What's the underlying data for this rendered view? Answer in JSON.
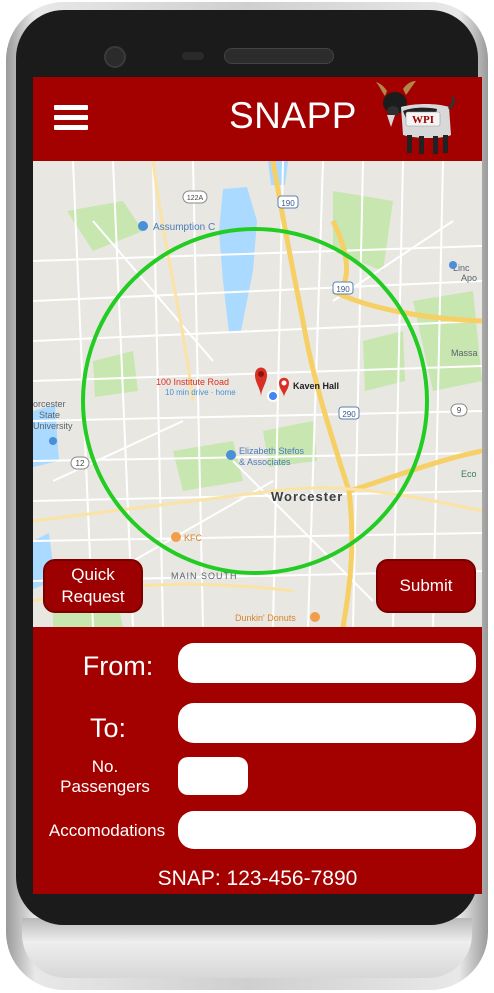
{
  "app": {
    "title": "SNAPP",
    "logo_text": "WPI",
    "menu_icon": "hamburger-menu-icon"
  },
  "map": {
    "labels": {
      "assumption": "Assumption C",
      "institute_road": "100 Institute Road",
      "drive_time": "10 min drive · home",
      "kaven_hall": "Kaven Hall",
      "elizabeth_1": "Elizabeth Stefos",
      "elizabeth_2": "& Associates",
      "worcester": "Worcester",
      "kfc": "KFC",
      "main_south": "MAIN SOUTH",
      "dunkin": "Dunkin' Donuts",
      "state_univ_1": "orcester",
      "state_univ_2": "State",
      "state_univ_3": "University",
      "massa": "Massa",
      "linc": "Linc",
      "apo": "Apo",
      "eco": "Eco",
      "hwy_190_a": "190",
      "hwy_190_b": "190",
      "hwy_290": "290",
      "hwy_122a": "122A",
      "hwy_9": "9",
      "hwy_12": "12"
    },
    "colors": {
      "radius_circle": "#22cc22",
      "pin_red": "#d93025",
      "highway": "#f6cf65",
      "water": "#aadaff",
      "park": "#c8e6b0"
    }
  },
  "buttons": {
    "quick_request_line1": "Quick",
    "quick_request_line2": "Request",
    "submit": "Submit"
  },
  "form": {
    "from_label": "From:",
    "to_label": "To:",
    "passengers_label_line1": "No.",
    "passengers_label_line2": "Passengers",
    "accommodations_label": "Accomodations",
    "from_value": "",
    "to_value": "",
    "passengers_value": "",
    "accommodations_value": ""
  },
  "footer": {
    "snap_phone": "SNAP: 123-456-7890"
  },
  "theme": {
    "primary": "#a30000",
    "text": "#ffffff"
  }
}
